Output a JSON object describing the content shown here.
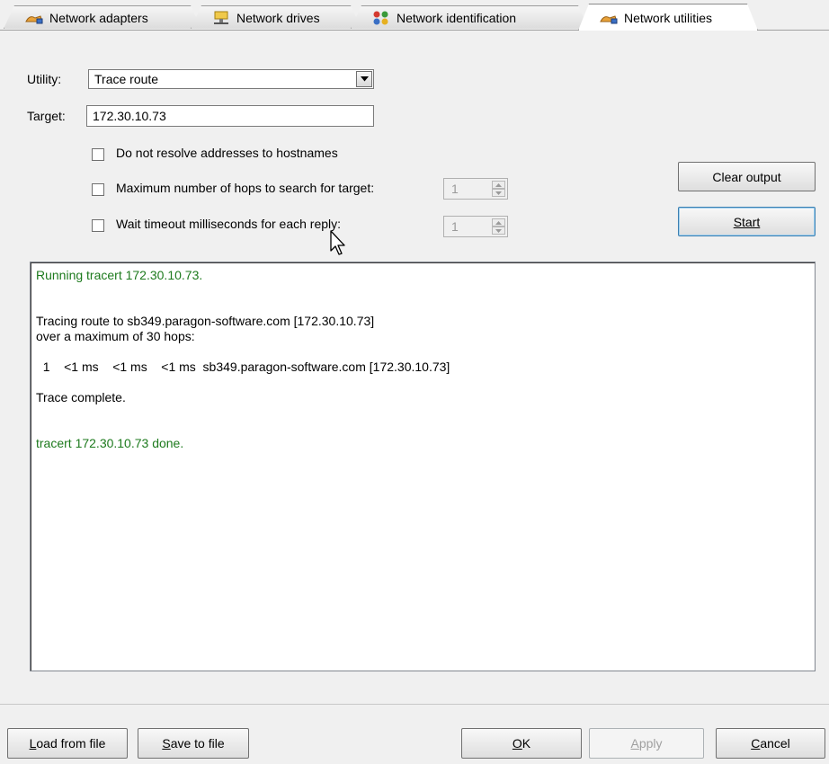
{
  "tabs": [
    {
      "label": "Network adapters",
      "icon": "network-adapter-icon",
      "active": false
    },
    {
      "label": "Network drives",
      "icon": "network-drive-icon",
      "active": false
    },
    {
      "label": "Network identification",
      "icon": "network-identification-icon",
      "active": false
    },
    {
      "label": "Network utilities",
      "icon": "network-utility-icon",
      "active": true
    }
  ],
  "form": {
    "utility_label": "Utility:",
    "utility_value": "Trace route",
    "target_label": "Target:",
    "target_value": "172.30.10.73",
    "options": [
      {
        "label": "Do not resolve addresses to hostnames",
        "checked": false
      },
      {
        "label": "Maximum number of hops to search for target:",
        "checked": false,
        "value": "1"
      },
      {
        "label": "Wait timeout milliseconds for each reply:",
        "checked": false,
        "value": "1"
      }
    ]
  },
  "actions": {
    "clear_output": "Clear output",
    "start": "Start"
  },
  "output": [
    {
      "text": "Running tracert 172.30.10.73.",
      "color": "#1d7a1d"
    },
    {
      "text": "",
      "color": "#000000"
    },
    {
      "text": "",
      "color": "#000000"
    },
    {
      "text": "Tracing route to sb349.paragon-software.com [172.30.10.73]",
      "color": "#000000"
    },
    {
      "text": "over a maximum of 30 hops:",
      "color": "#000000"
    },
    {
      "text": "",
      "color": "#000000"
    },
    {
      "text": "  1    <1 ms    <1 ms    <1 ms  sb349.paragon-software.com [172.30.10.73]",
      "color": "#000000"
    },
    {
      "text": "",
      "color": "#000000"
    },
    {
      "text": "Trace complete.",
      "color": "#000000"
    },
    {
      "text": "",
      "color": "#000000"
    },
    {
      "text": "",
      "color": "#000000"
    },
    {
      "text": "tracert 172.30.10.73 done.",
      "color": "#1d7a1d"
    }
  ],
  "footer": {
    "load": "Load from file",
    "save": "Save to file",
    "ok": "OK",
    "apply": "Apply",
    "cancel": "Cancel"
  }
}
